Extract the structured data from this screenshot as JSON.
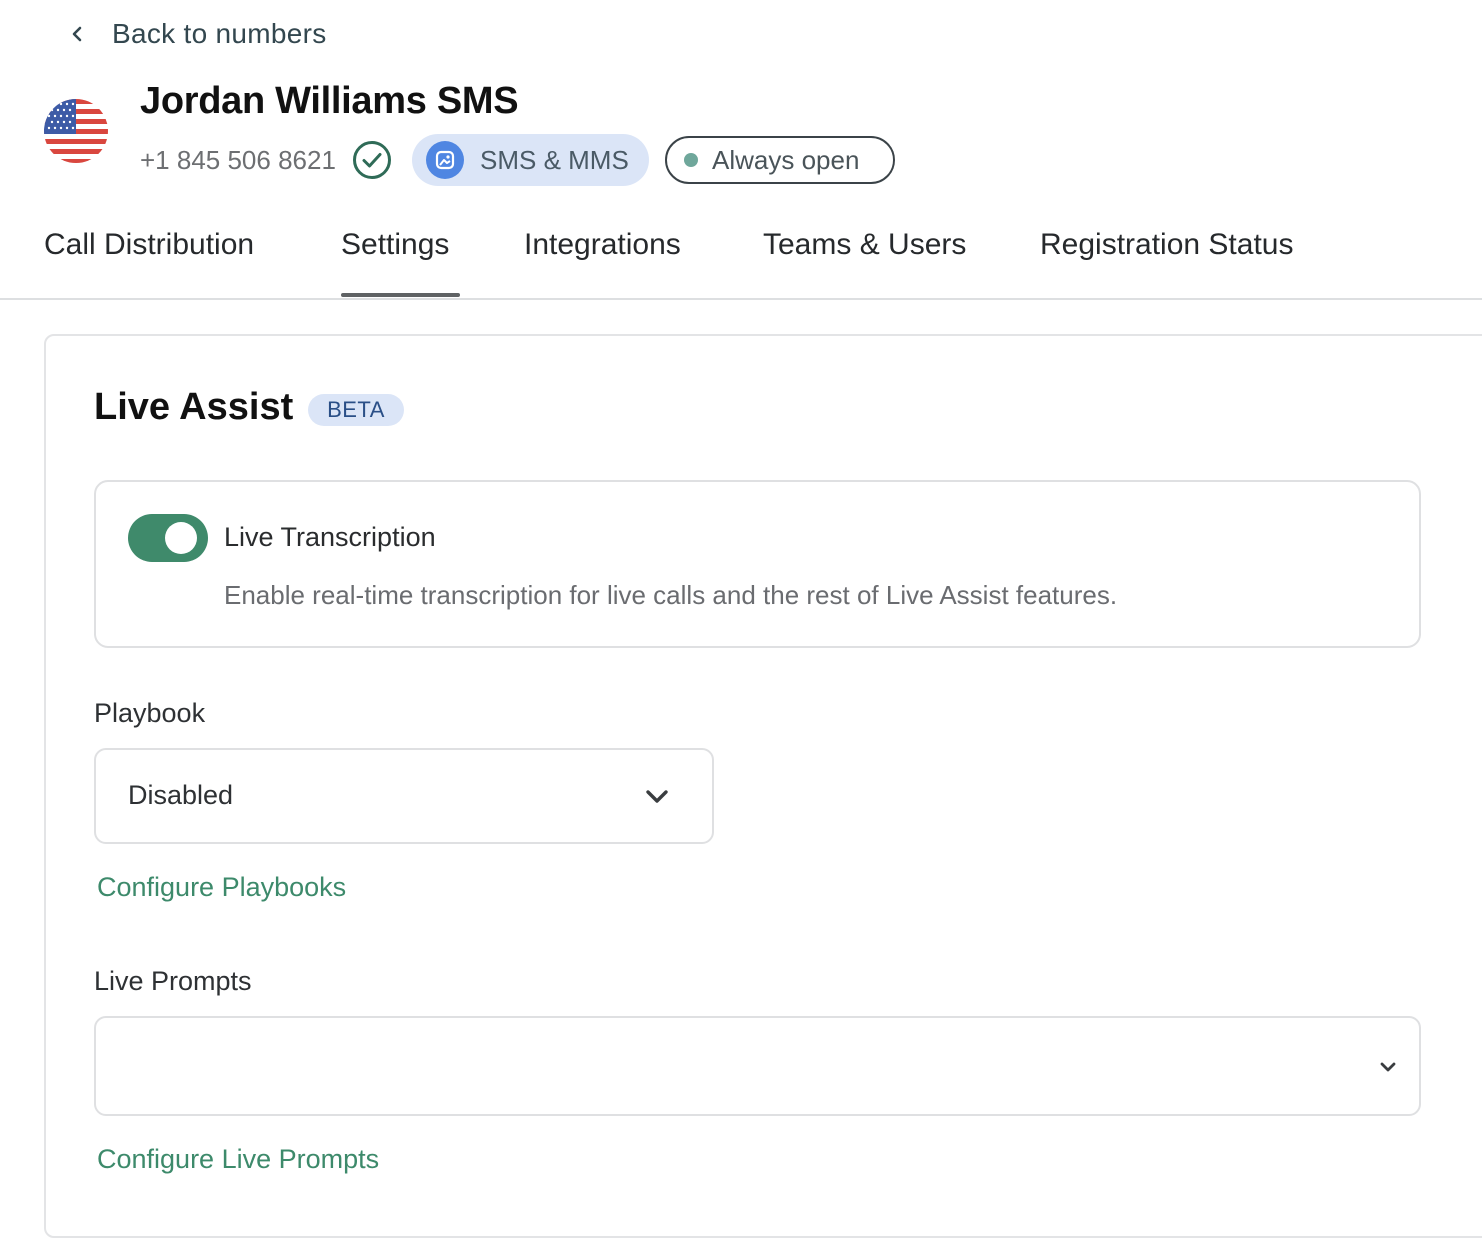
{
  "back": {
    "label": "Back to numbers"
  },
  "header": {
    "title": "Jordan Williams SMS",
    "phone": "+1 845 506 8621",
    "sms_pill": "SMS & MMS",
    "hours_pill": "Always open"
  },
  "tabs": [
    {
      "label": "Call Distribution",
      "active": false
    },
    {
      "label": "Settings",
      "active": true
    },
    {
      "label": "Integrations",
      "active": false
    },
    {
      "label": "Teams & Users",
      "active": false
    },
    {
      "label": "Registration Status",
      "active": false
    }
  ],
  "live_assist": {
    "title": "Live Assist",
    "badge": "BETA",
    "transcription": {
      "label": "Live Transcription",
      "description": "Enable real-time transcription for live calls and the rest of Live Assist features.",
      "enabled": true
    },
    "playbook": {
      "label": "Playbook",
      "value": "Disabled",
      "link": "Configure Playbooks"
    },
    "live_prompts": {
      "label": "Live Prompts",
      "value": "",
      "link": "Configure Live Prompts"
    }
  },
  "colors": {
    "accent_green": "#3f8a6b",
    "link_green": "#3d8a6b",
    "badge_bg": "#dbe5f7",
    "badge_text": "#2a4f87"
  }
}
